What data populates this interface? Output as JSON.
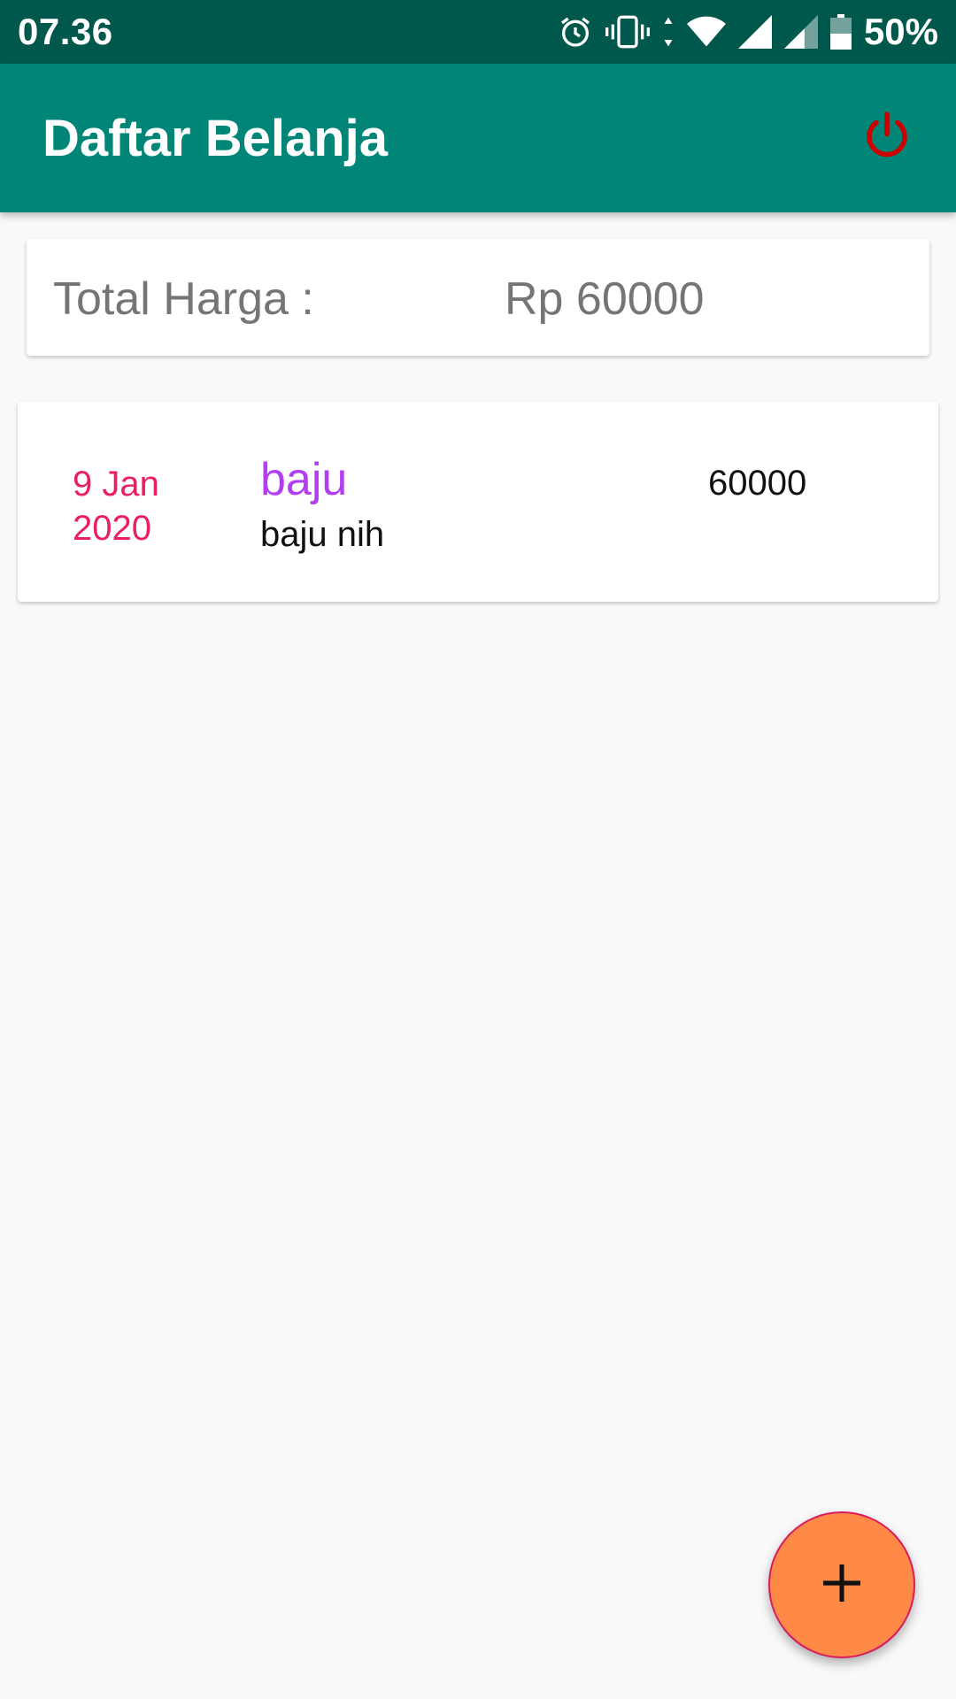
{
  "status_bar": {
    "time": "07.36",
    "battery_percent": "50%",
    "icons": [
      "alarm-icon",
      "vibrate-icon",
      "data-arrows-icon",
      "wifi-icon",
      "signal-icon",
      "signal-icon-2",
      "battery-icon"
    ]
  },
  "app_bar": {
    "title": "Daftar Belanja",
    "action_icon": "power-icon",
    "action_color": "#cc0000"
  },
  "total": {
    "label": "Total Harga :",
    "value": "Rp 60000"
  },
  "items": [
    {
      "date": "9 Jan 2020",
      "name": "baju",
      "description": "baju nih",
      "price": "60000"
    }
  ],
  "fab": {
    "icon": "plus-icon",
    "color": "#ff8a47"
  },
  "colors": {
    "primary": "#008577",
    "primary_dark": "#00574b",
    "date_color": "#e91e63",
    "name_color": "#b33ef0"
  }
}
